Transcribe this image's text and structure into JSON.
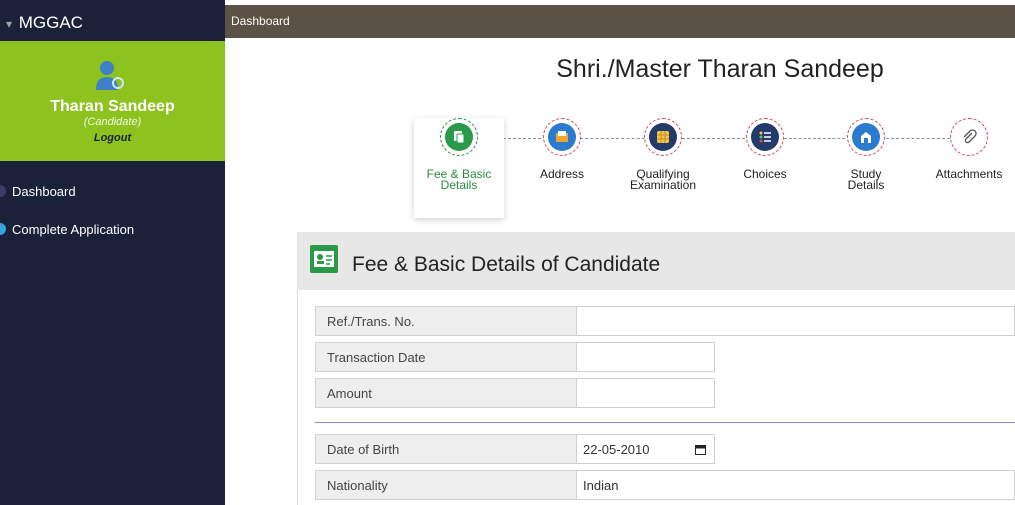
{
  "brand": "MGGAC",
  "topbar": {
    "title": "Dashboard"
  },
  "profile": {
    "name": "Tharan Sandeep",
    "role": "(Candidate)",
    "logout": "Logout"
  },
  "sidebar": {
    "items": [
      {
        "label": "Dashboard"
      },
      {
        "label": "Complete Application"
      }
    ]
  },
  "header": {
    "candidate_title": "Shri./Master Tharan Sandeep"
  },
  "steps": [
    {
      "line1": "Fee & Basic",
      "line2": "Details",
      "active": true,
      "icon": "document-icon"
    },
    {
      "line1": "Address",
      "line2": "",
      "active": false,
      "icon": "address-card-icon"
    },
    {
      "line1": "Qualifying",
      "line2": "Examination",
      "active": false,
      "icon": "grid-icon"
    },
    {
      "line1": "Choices",
      "line2": "",
      "active": false,
      "icon": "list-icon"
    },
    {
      "line1": "Study",
      "line2": "Details",
      "active": false,
      "icon": "building-icon"
    },
    {
      "line1": "Attachments",
      "line2": "",
      "active": false,
      "icon": "paperclip-icon"
    }
  ],
  "panel": {
    "title": "Fee & Basic Details of Candidate",
    "fields": [
      {
        "label": "Ref./Trans. No.",
        "value": ""
      },
      {
        "label": "Transaction Date",
        "value": ""
      },
      {
        "label": "Amount",
        "value": ""
      },
      {
        "label": "Date of Birth",
        "value": "22-05-2010"
      },
      {
        "label": "Nationality",
        "value": "Indian"
      }
    ]
  },
  "colors": {
    "sidebar": "#1c213a",
    "profile": "#8dc21f",
    "topbar": "#5b5145",
    "active_step": "#2a8a3e"
  }
}
